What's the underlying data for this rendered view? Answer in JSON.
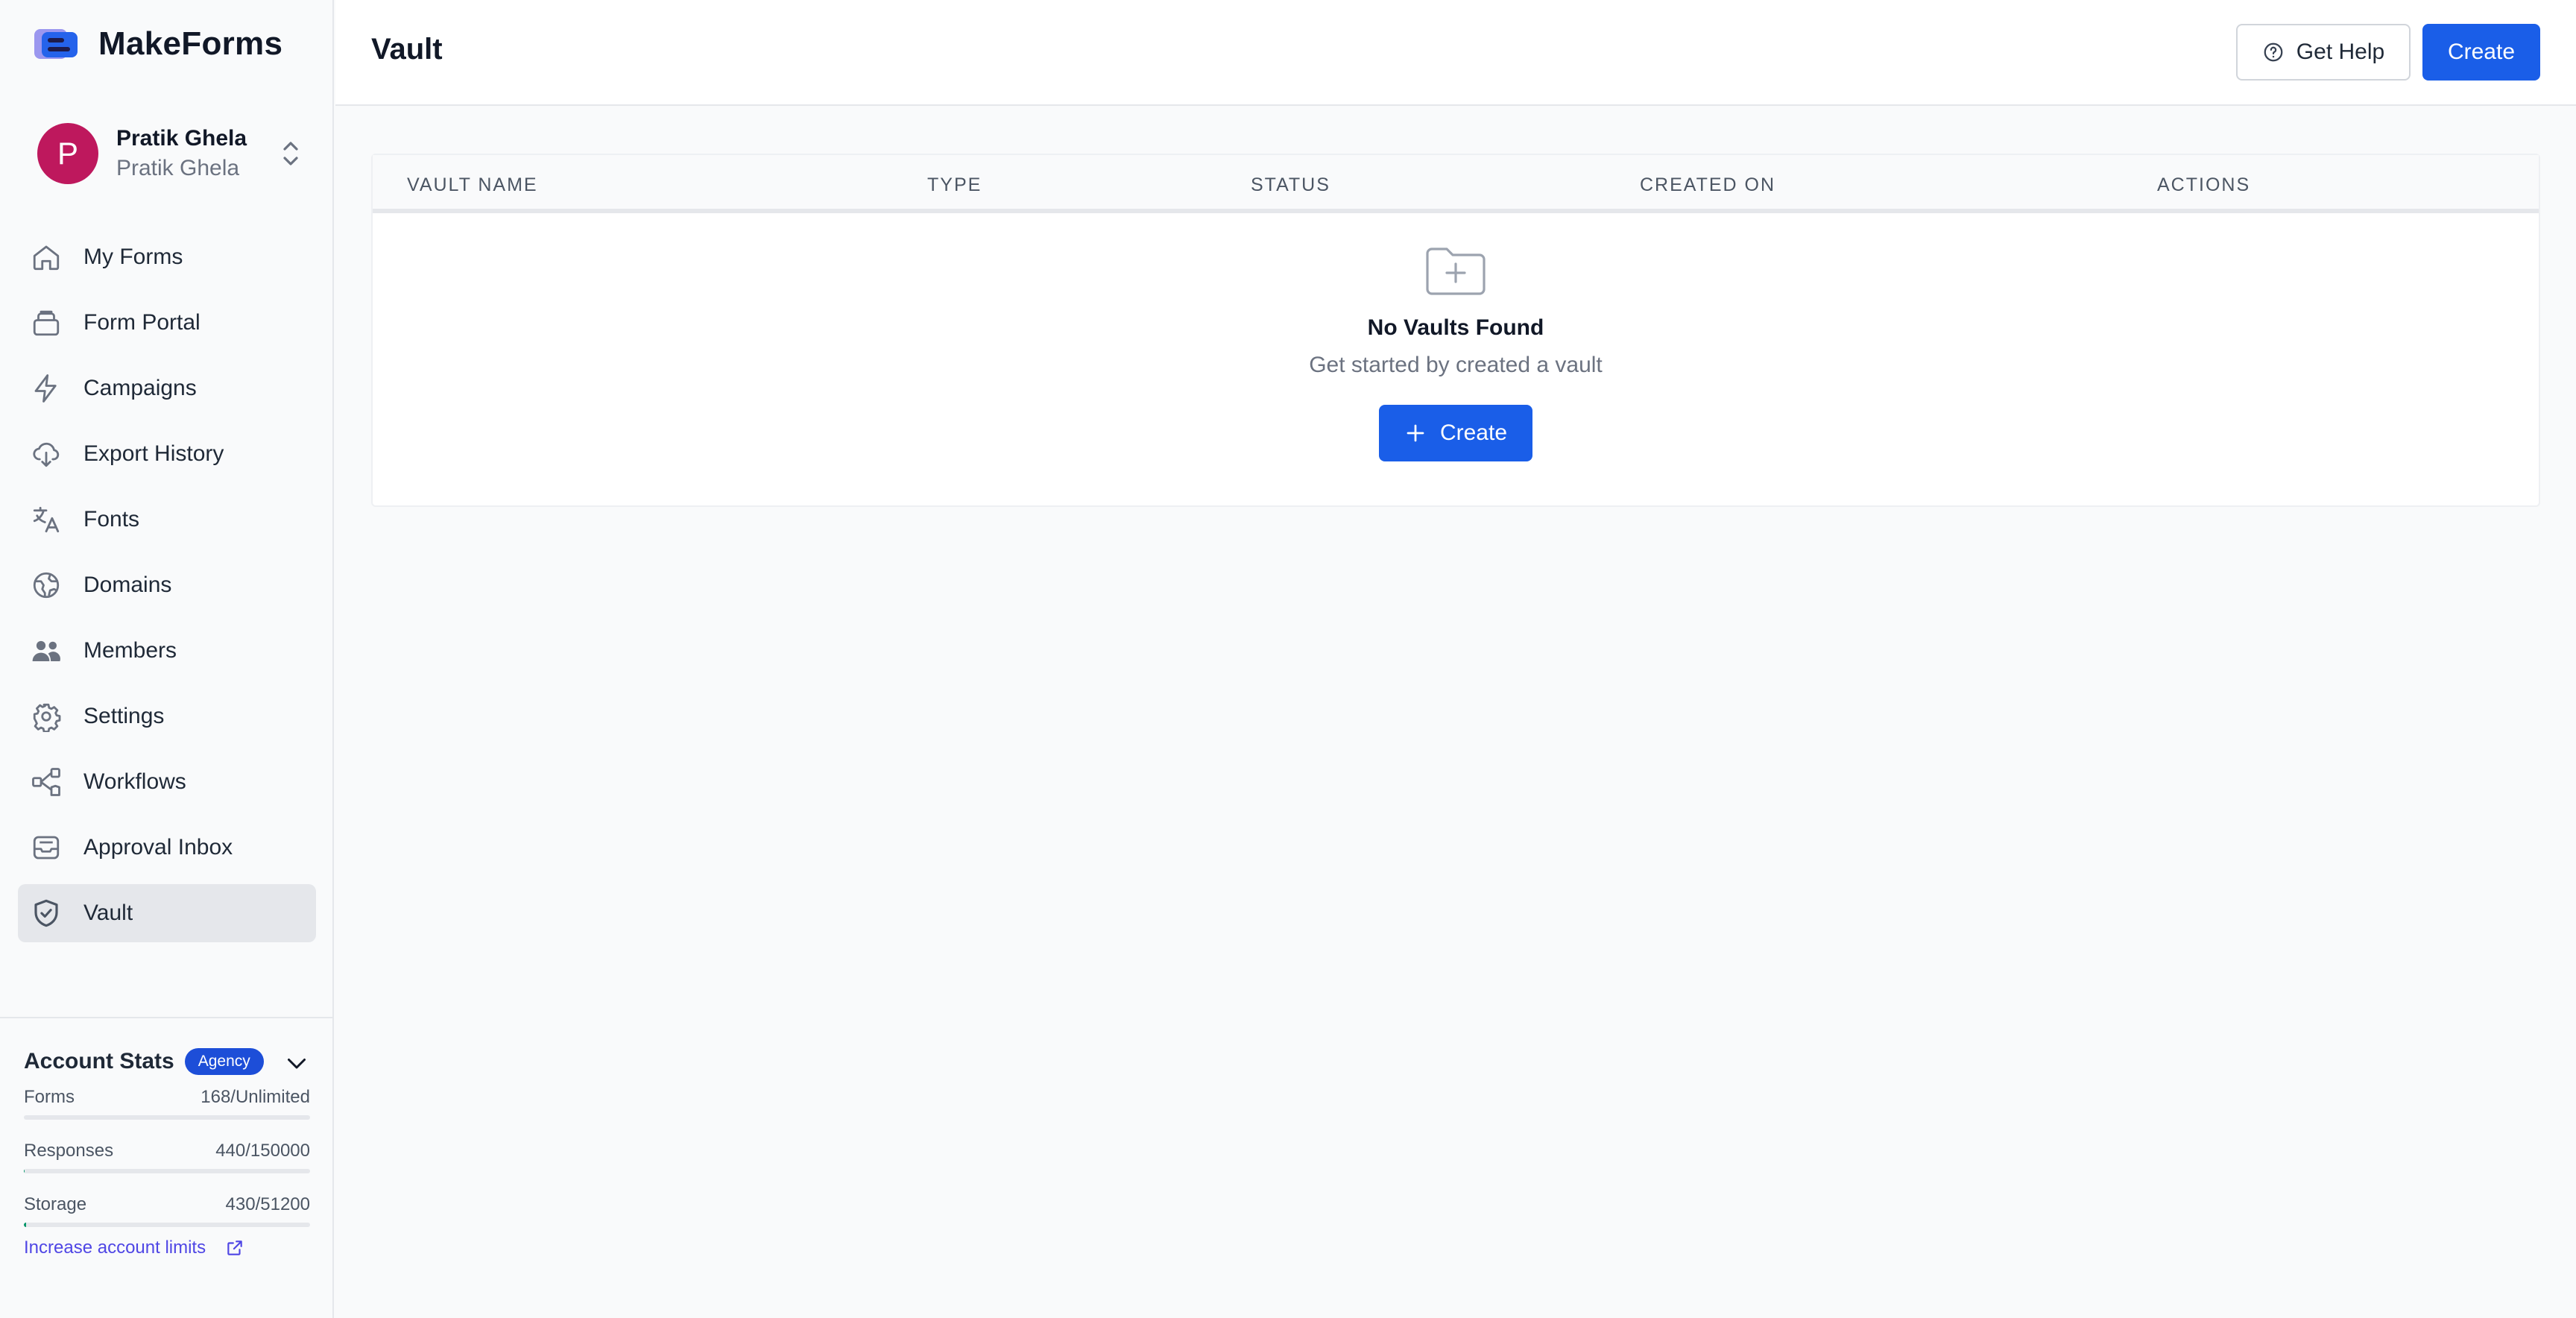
{
  "app": {
    "name": "MakeForms"
  },
  "user": {
    "name": "Pratik Ghela",
    "org": "Pratik Ghela",
    "initial": "P"
  },
  "sidebar": {
    "items": [
      {
        "label": "My Forms",
        "icon": "home-icon"
      },
      {
        "label": "Form Portal",
        "icon": "portal-icon"
      },
      {
        "label": "Campaigns",
        "icon": "bolt-icon"
      },
      {
        "label": "Export History",
        "icon": "cloud-download-icon"
      },
      {
        "label": "Fonts",
        "icon": "translate-icon"
      },
      {
        "label": "Domains",
        "icon": "globe-icon"
      },
      {
        "label": "Members",
        "icon": "users-icon"
      },
      {
        "label": "Settings",
        "icon": "gear-icon"
      },
      {
        "label": "Workflows",
        "icon": "workflow-icon"
      },
      {
        "label": "Approval Inbox",
        "icon": "inbox-icon"
      },
      {
        "label": "Vault",
        "icon": "shield-icon",
        "active": true
      }
    ]
  },
  "stats": {
    "title": "Account Stats",
    "badge": "Agency",
    "forms": {
      "label": "Forms",
      "value": "168/Unlimited",
      "fill": 0
    },
    "responses": {
      "label": "Responses",
      "value": "440/150000",
      "fill": 0.003
    },
    "storage": {
      "label": "Storage",
      "value": "430/51200",
      "fill": 0.008
    },
    "link": "Increase account limits"
  },
  "header": {
    "title": "Vault",
    "help_label": "Get Help",
    "create_label": "Create"
  },
  "table": {
    "columns": [
      "VAULT NAME",
      "TYPE",
      "STATUS",
      "CREATED ON",
      "ACTIONS"
    ],
    "rows": [],
    "empty_title": "No Vaults Found",
    "empty_subtitle": "Get started by created a vault",
    "empty_button": "Create"
  },
  "colors": {
    "primary": "#1a5ee8",
    "avatar": "#be185d",
    "badge": "#1d4ed8",
    "link": "#4f46e5"
  }
}
